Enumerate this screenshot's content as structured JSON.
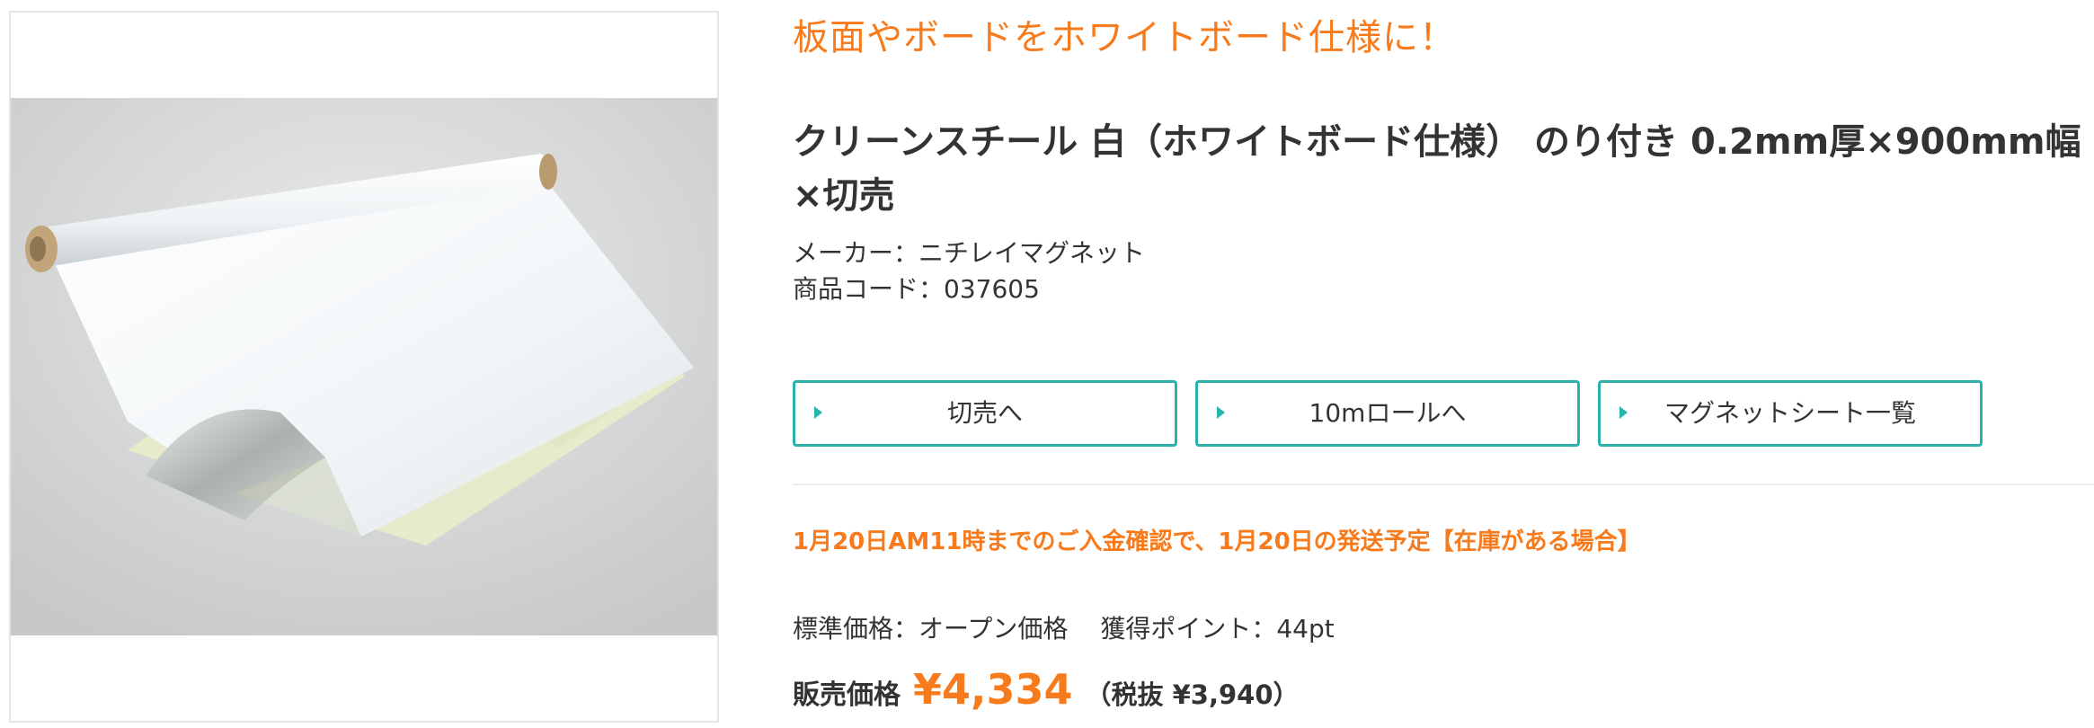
{
  "product": {
    "tagline": "板面やボードをホワイトボード仕様に！",
    "title": "クリーンスチール 白（ホワイトボード仕様） のり付き 0.2mm厚×900mm幅×切売",
    "maker": "メーカー：ニチレイマグネット",
    "code": "商品コード：037605",
    "image_alt": "クリーンスチール 白 のり付き"
  },
  "buttons": [
    {
      "label": "切売へ",
      "icon": "play-arrow-icon"
    },
    {
      "label": "10mロールへ",
      "icon": "play-arrow-icon"
    },
    {
      "label": "マグネットシート一覧",
      "icon": "play-arrow-icon"
    }
  ],
  "shipping": "1月20日AM11時までのご入金確認で、1月20日の発送予定【在庫がある場合】",
  "pricing": {
    "standard": "標準価格：オープン価格",
    "points": "獲得ポイント：44pt",
    "sale_label": "販売価格",
    "sale_price": "¥4,334",
    "tax_note": "（税抜 ¥3,940）"
  },
  "colors": {
    "accent_orange": "#f77b1c",
    "button_teal": "#2bb3ad",
    "text": "#333333"
  }
}
